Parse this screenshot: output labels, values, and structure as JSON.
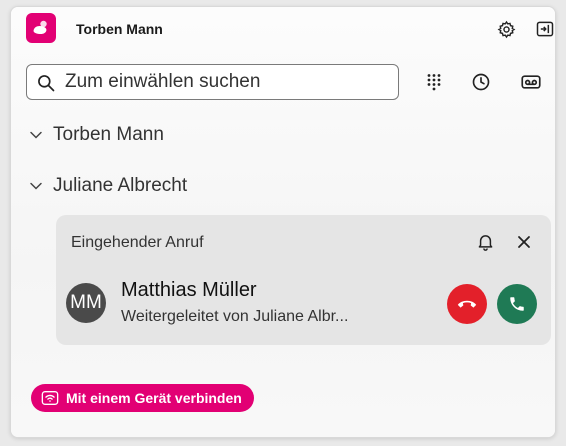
{
  "header": {
    "app_title": "Torben Mann",
    "settings_icon": "gear-icon",
    "signout_icon": "sign-out-icon",
    "logo_icon": "telekom-logo-icon"
  },
  "search": {
    "placeholder": "Zum einwählen suchen",
    "value": ""
  },
  "toolbar": {
    "icons": [
      "dialpad-icon",
      "history-clock-icon",
      "voicemail-icon"
    ]
  },
  "groups": [
    {
      "label": "Torben Mann"
    },
    {
      "label": "Juliane Albrecht"
    }
  ],
  "incoming_call": {
    "title": "Eingehender Anruf",
    "caller_initials": "MM",
    "caller_name": "Matthias Müller",
    "caller_sub": "Weitergeleitet von Juliane Albr..."
  },
  "footer": {
    "connect_label": "Mit einem Gerät verbinden"
  },
  "colors": {
    "brand": "#e20074",
    "decline": "#e3202a",
    "accept": "#1f7a55"
  }
}
